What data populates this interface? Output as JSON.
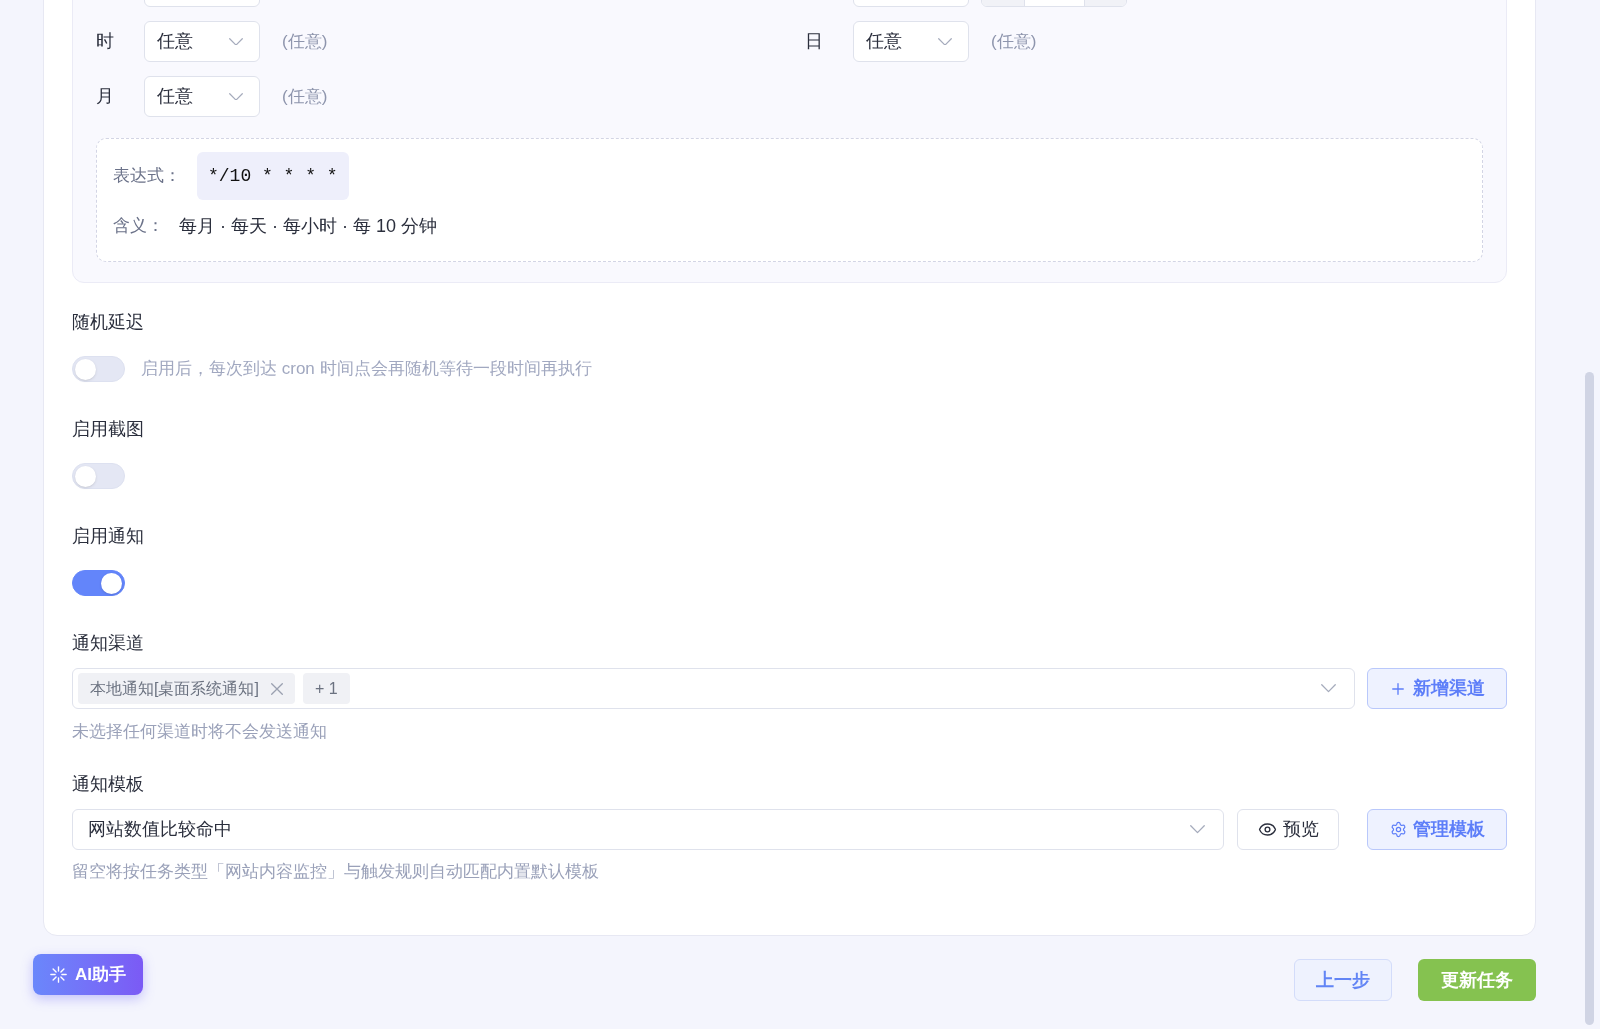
{
  "cron_panel": {
    "cut_off_row": [
      {
        "controls": [
          {
            "kind": "select"
          }
        ]
      },
      {
        "controls": [
          {
            "kind": "select"
          },
          {
            "kind": "stepper"
          }
        ]
      }
    ],
    "fields": [
      {
        "label": "时",
        "value": "任意",
        "note": "(任意)"
      },
      {
        "label": "日",
        "value": "任意",
        "note": "(任意)"
      },
      {
        "label": "月",
        "value": "任意",
        "note": "(任意)"
      }
    ],
    "expression": {
      "label": "表达式：",
      "value": "*/10 * * * *"
    },
    "meaning": {
      "label": "含义：",
      "value": "每月 · 每天 · 每小时 · 每 10 分钟"
    }
  },
  "switches": [
    {
      "label": "随机延迟",
      "on": false,
      "description": "启用后，每次到达 cron 时间点会再随机等待一段时间再执行"
    },
    {
      "label": "启用截图",
      "on": false
    },
    {
      "label": "启用通知",
      "on": true
    }
  ],
  "channels": {
    "label": "通知渠道",
    "tags": [
      {
        "text": "本地通知[桌面系统通知]",
        "removable": true
      },
      {
        "text": "+ 1",
        "removable": false
      }
    ],
    "add_button": "新增渠道",
    "hint": "未选择任何渠道时将不会发送通知"
  },
  "template": {
    "label": "通知模板",
    "value": "网站数值比较命中",
    "preview_button": "预览",
    "manage_button": "管理模板",
    "hint": "留空将按任务类型「网站内容监控」与触发规则自动匹配内置默认模板"
  },
  "footer": {
    "assistant_button": "AI助手",
    "back_button": "上一步",
    "submit_button": "更新任务"
  }
}
